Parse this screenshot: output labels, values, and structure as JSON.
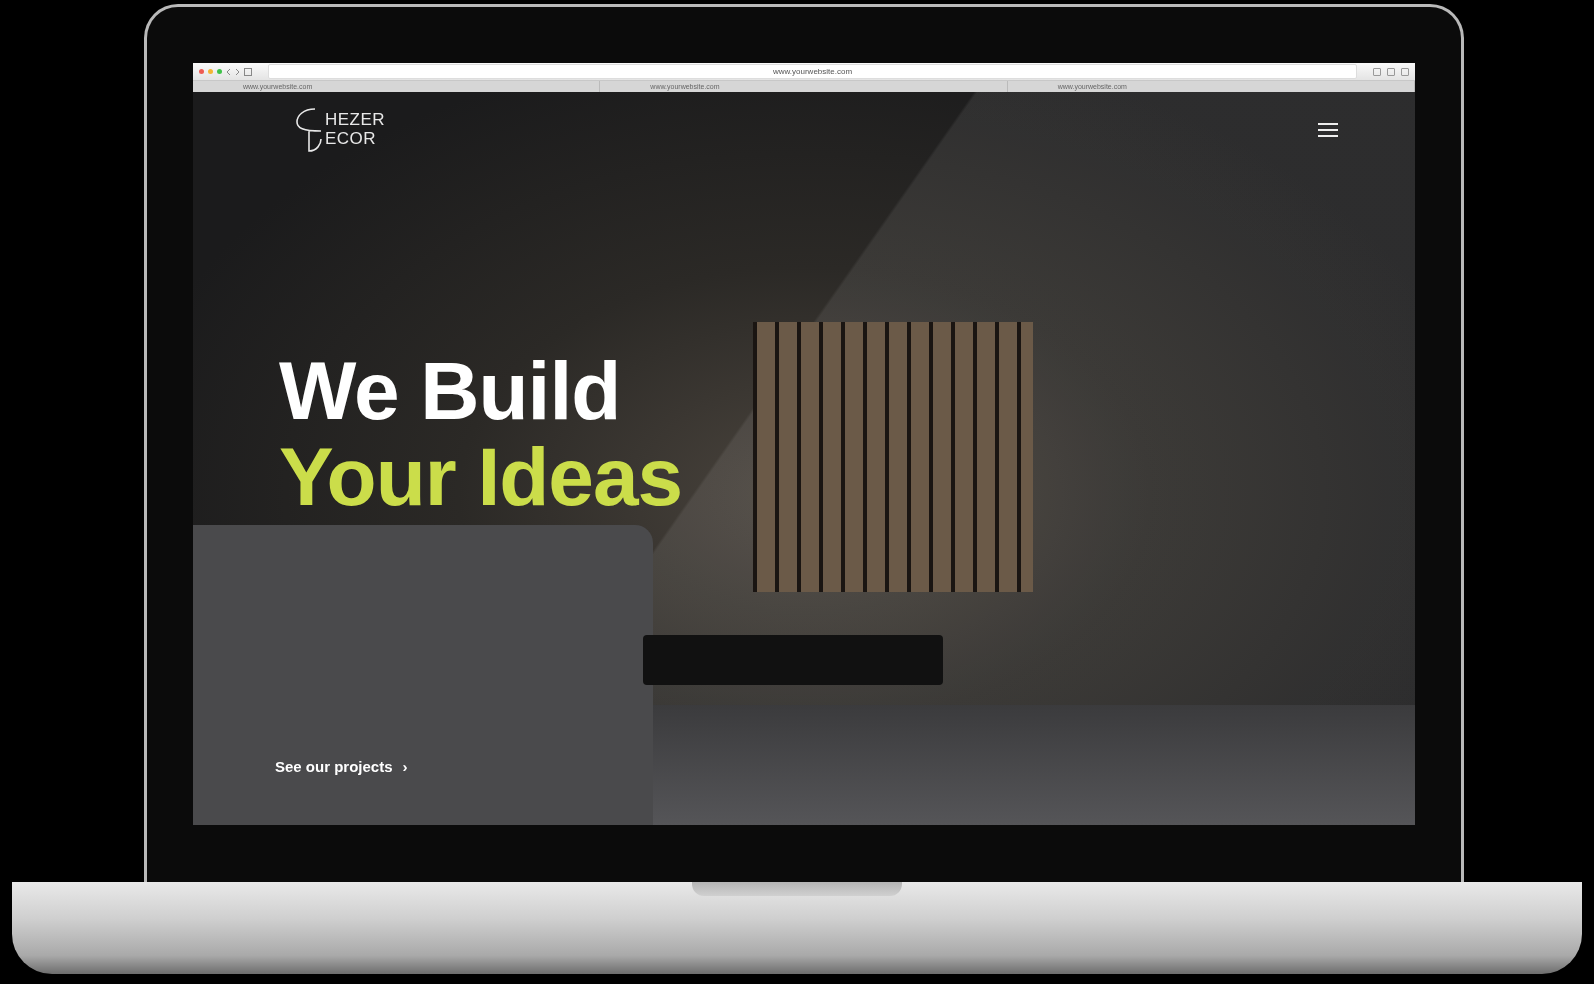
{
  "browser": {
    "address": "www.yourwebsite.com",
    "tabs": [
      {
        "label": "www.yourwebsite.com"
      },
      {
        "label": "www.yourwebsite.com"
      },
      {
        "label": "www.yourwebsite.com"
      }
    ]
  },
  "site": {
    "logo": {
      "top": "HEZER",
      "bottom": "ECOR"
    },
    "headline": {
      "line_1": "We Build",
      "line_2": "Your Ideas"
    },
    "cta": {
      "label": "See our projects",
      "arrow": "›"
    }
  }
}
